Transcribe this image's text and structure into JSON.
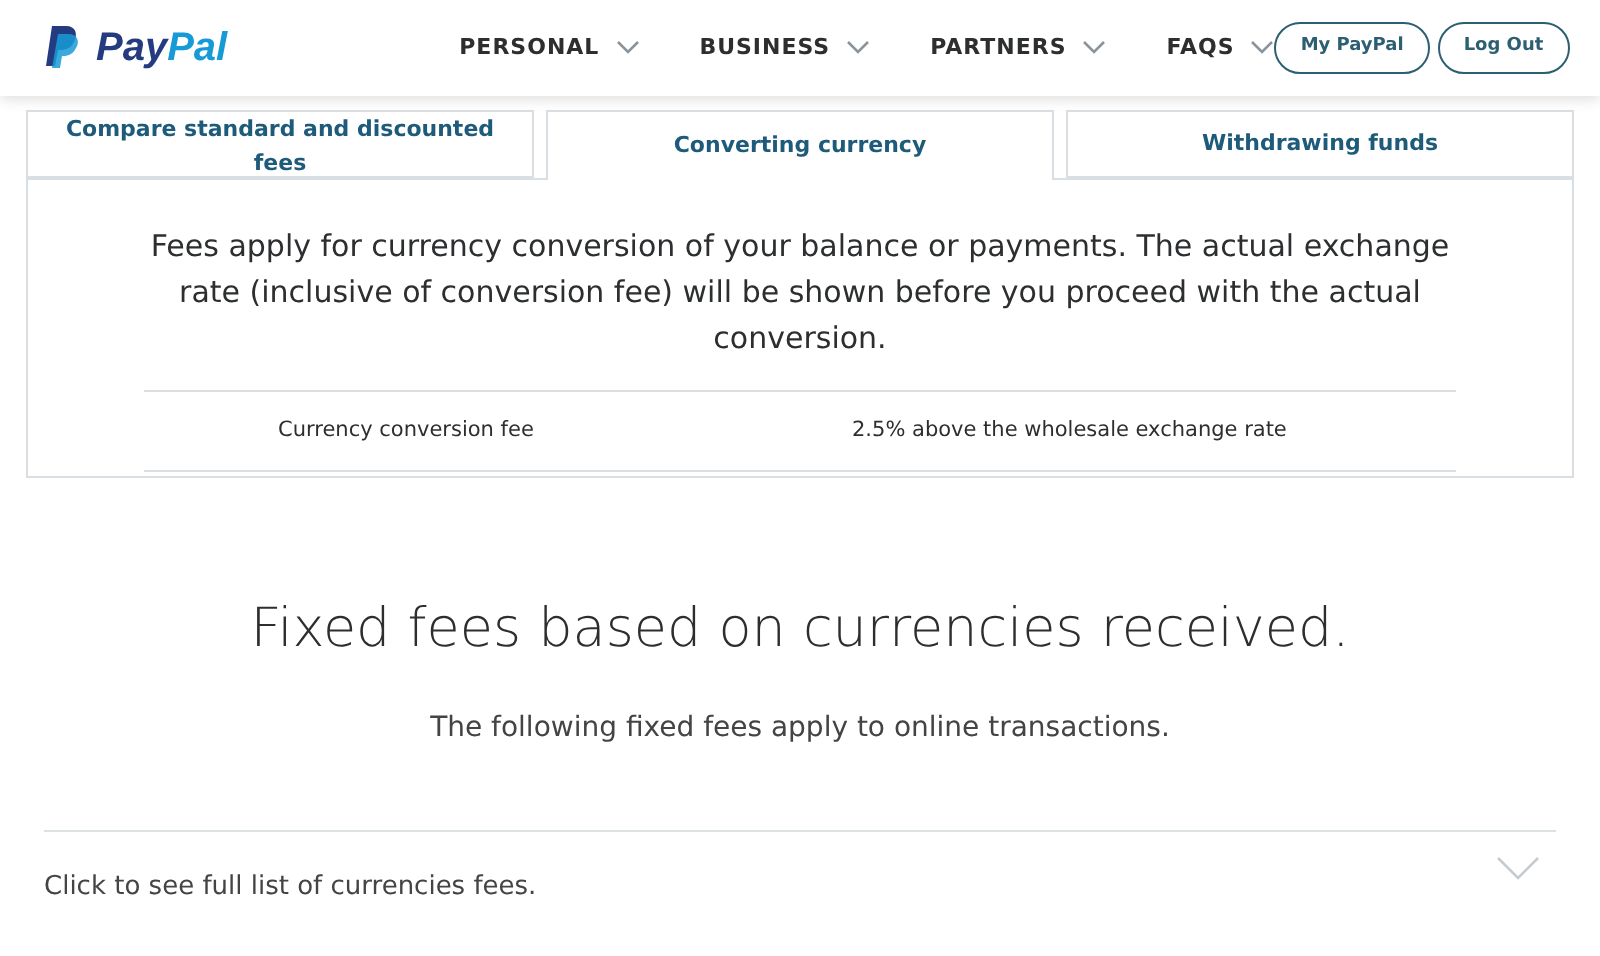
{
  "header": {
    "logo_parts": [
      "Pay",
      "Pal"
    ],
    "nav": [
      {
        "label": "PERSONAL"
      },
      {
        "label": "BUSINESS"
      },
      {
        "label": "PARTNERS"
      },
      {
        "label": "FAQS"
      }
    ],
    "buttons": [
      "My PayPal",
      "Log Out"
    ]
  },
  "tabs": [
    {
      "label": "Compare standard and discounted fees",
      "selected": false
    },
    {
      "label": "Converting currency",
      "selected": true
    },
    {
      "label": "Withdrawing funds",
      "selected": false
    }
  ],
  "panel": {
    "intro": "Fees apply for currency conversion of your balance or payments. The actual exchange rate (inclusive of conversion fee) will be shown before you proceed with the actual conversion.",
    "rows": [
      {
        "label": "Currency conversion fee",
        "value": "2.5% above the wholesale exchange rate"
      }
    ]
  },
  "section": {
    "heading": "Fixed fees based on currencies received.",
    "subtitle": "The following fixed fees apply to online transactions.",
    "expander": {
      "label": "Click to see full list of currencies fees.",
      "expanded": false
    }
  }
}
